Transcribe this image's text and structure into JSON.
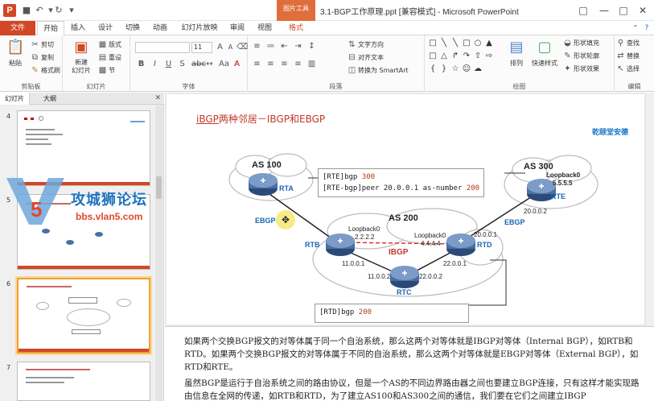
{
  "app": {
    "window_title": "3.1-BGP工作原理.ppt [兼容模式] - Microsoft PowerPoint",
    "context_group": "图片工具",
    "accent": "#d24726"
  },
  "ribbon": {
    "tabs": [
      "文件",
      "开始",
      "插入",
      "设计",
      "切换",
      "动画",
      "幻灯片放映",
      "审阅",
      "视图",
      "格式"
    ],
    "active_tab": "开始",
    "groups": {
      "clipboard": {
        "label": "剪贴板",
        "paste": "粘贴",
        "cut": "剪切",
        "copy": "复制",
        "format_painter": "格式刷"
      },
      "slides": {
        "label": "幻灯片",
        "new_slide": "新建\n幻灯片",
        "layout": "版式",
        "reset": "重设",
        "section": "节"
      },
      "font": {
        "label": "字体",
        "size": "11"
      },
      "paragraph": {
        "label": "段落",
        "text_direction": "文字方向",
        "align_text": "对齐文本",
        "smartart": "转换为 SmartArt"
      },
      "drawing": {
        "label": "绘图",
        "arrange": "排列",
        "quick_styles": "快速样式",
        "shape_fill": "形状填充",
        "shape_outline": "形状轮廓",
        "shape_effects": "形状效果"
      },
      "editing": {
        "label": "编辑",
        "find": "查找",
        "replace": "替换",
        "select": "选择"
      }
    }
  },
  "panel": {
    "tabs": [
      "幻灯片",
      "大纲"
    ],
    "slides": [
      {
        "number": "4"
      },
      {
        "number": "5"
      },
      {
        "number": "6"
      },
      {
        "number": "7"
      }
    ]
  },
  "watermark": {
    "text": "攻城狮论坛",
    "url": "bbs.vlan5.com"
  },
  "slide": {
    "title_prefix": "iBGP",
    "title_rest": "两种邻居－IBGP和EBGP",
    "brand": "乾颐堂安德",
    "rte_config": {
      "line1_cmd": "[RTE]bgp ",
      "line1_num": "300",
      "line2_cmd": "[RTE-bgp]peer 20.0.0.1 as-number ",
      "line2_num": "200"
    },
    "rtd_config": {
      "line1_cmd": "[RTD]bgp ",
      "line1_num": "200"
    },
    "labels": {
      "as100": "AS 100",
      "as200": "AS 200",
      "as300": "AS 300",
      "rta": "RTA",
      "rtb": "RTB",
      "rtc": "RTC",
      "rtd": "RTD",
      "rte": "RTE",
      "ebgp_left": "EBGP",
      "ebgp_right": "EBGP",
      "ibgp": "IBGP",
      "lb0_rtb": "Loopback0",
      "lb0_rtb_ip": "2.2.2.2",
      "lb0_rtd": "Loopback0",
      "lb0_rtd_ip": "4.4.4.4",
      "lb0_rte": "Loopback0",
      "lb0_rte_ip": "5.5.5.5",
      "ip_rte": "20.0.0.2",
      "ip_rtd_up": "20.0.0.1",
      "ip_rtb": "11.0.0.1",
      "ip_rtc_left": "11.0.0.2",
      "ip_rtc_right": "22.0.0.2",
      "ip_rtd_down": "22.0.0.1"
    }
  },
  "notes": {
    "para1": "如果两个交换BGP报文的对等体属于同一个自治系统，那么这两个对等体就是IBGP对等体（Internal BGP），如RTB和RTD。如果两个交换BGP报文的对等体属于不同的自治系统，那么这两个对等体就是EBGP对等体（External BGP），如RTD和RTE。",
    "para2": "虽然BGP是运行于自治系统之间的路由协议，但是一个AS的不同边界路由器之间也要建立BGP连接，只有这样才能实现路由信息在全网的传递，如RTB和RTD，为了建立AS100和AS300之间的通信，我们要在它们之间建立IBGP"
  }
}
